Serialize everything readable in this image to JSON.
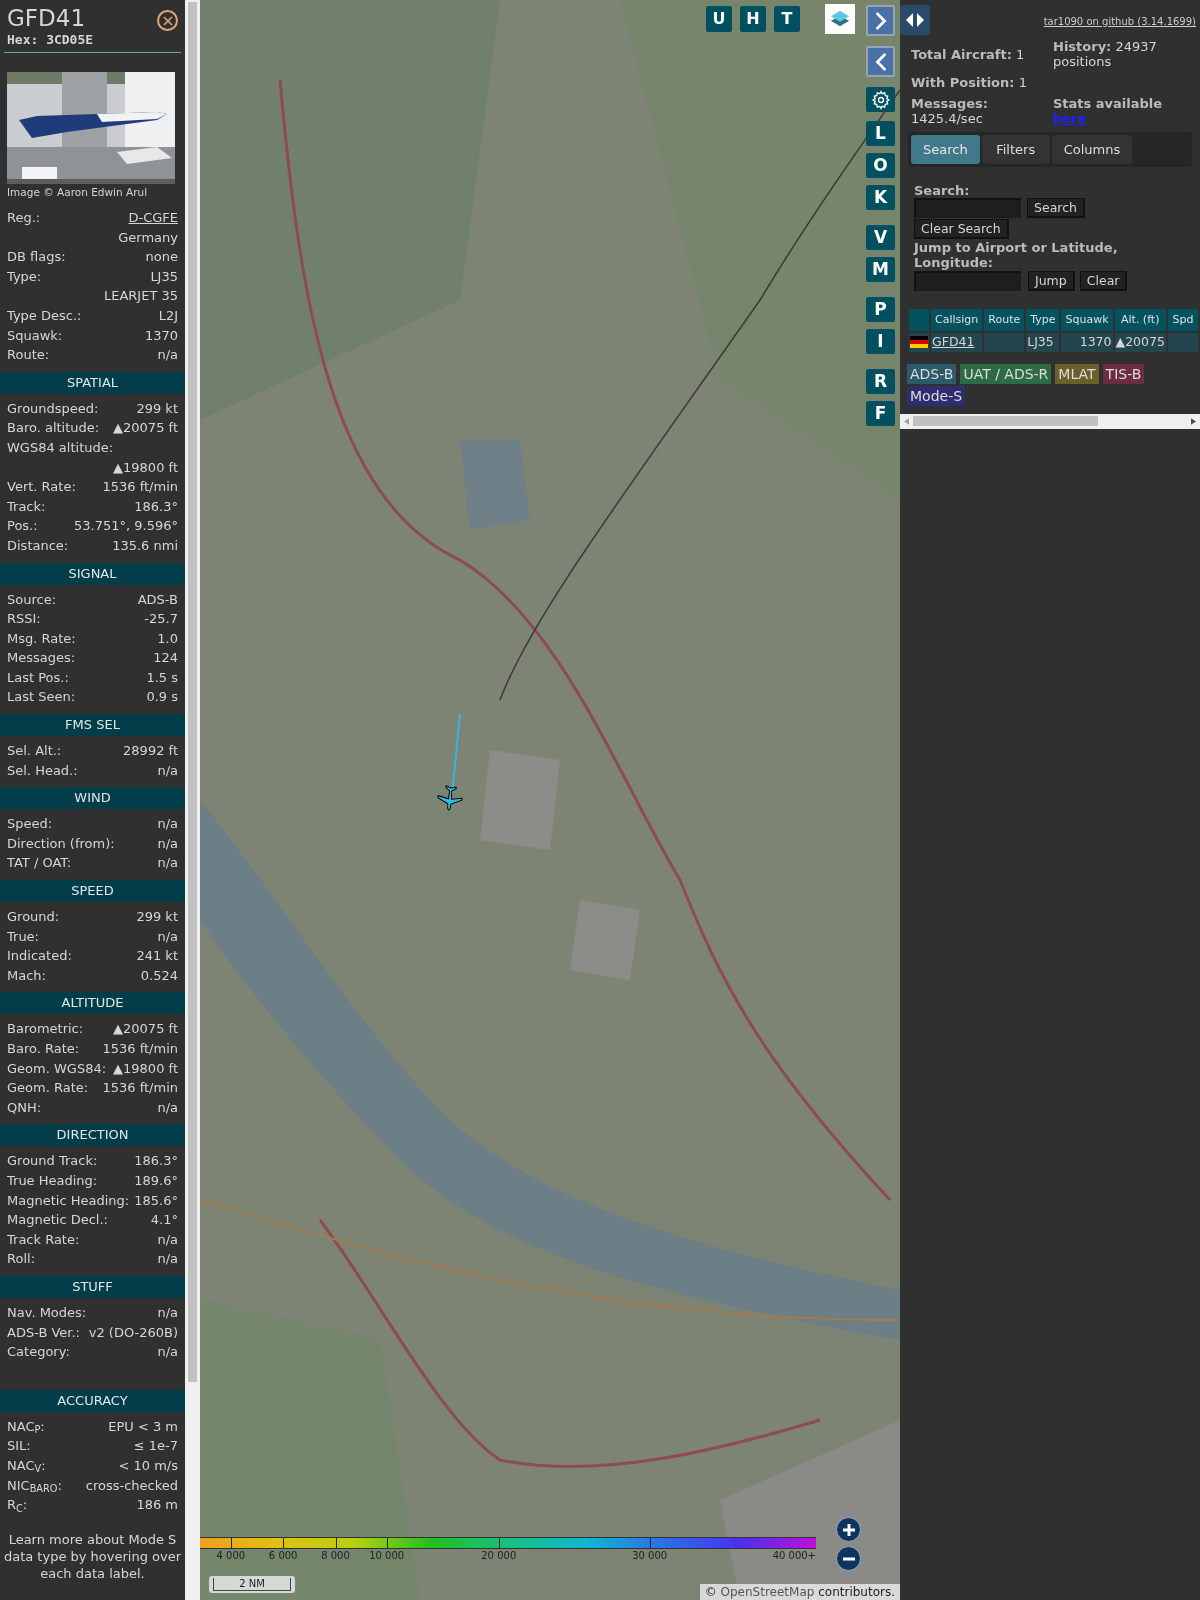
{
  "details": {
    "title": "GFD41",
    "hex": "Hex: 3CD05E",
    "photo_credit": "Image © Aaron Edwin Arul",
    "sections": [
      {
        "rows": [
          {
            "label": "Reg.:",
            "value": "D-CGFE",
            "kind": "link"
          },
          {
            "value": "Germany"
          },
          {
            "label": "DB flags:",
            "value": "none"
          },
          {
            "label": "Type:",
            "value": "LJ35"
          },
          {
            "value": "LEARJET 35"
          },
          {
            "label": "Type Desc.:",
            "value": "L2J"
          },
          {
            "label": "Squawk:",
            "value": "1370"
          },
          {
            "label": "Route:",
            "value": "n/a"
          }
        ]
      },
      {
        "heading": "SPATIAL",
        "rows": [
          {
            "label": "Groundspeed:",
            "value": "299 kt"
          },
          {
            "label": "Baro. altitude:",
            "value": "▲20075 ft"
          },
          {
            "label": "WGS84 altitude:"
          },
          {
            "value": "▲19800 ft"
          },
          {
            "label": "Vert. Rate:",
            "value": "1536 ft/min"
          },
          {
            "label": "Track:",
            "value": "186.3°"
          },
          {
            "label": "Pos.:",
            "value": "53.751°, 9.596°"
          },
          {
            "label": "Distance:",
            "value": "135.6 nmi"
          }
        ]
      },
      {
        "heading": "SIGNAL",
        "rows": [
          {
            "label": "Source:",
            "value": "ADS-B"
          },
          {
            "label": "RSSI:",
            "value": "-25.7"
          },
          {
            "label": "Msg. Rate:",
            "value": "1.0"
          },
          {
            "label": "Messages:",
            "value": "124"
          },
          {
            "label": "Last Pos.:",
            "value": "1.5 s"
          },
          {
            "label": "Last Seen:",
            "value": "0.9 s"
          }
        ]
      },
      {
        "heading": "FMS SEL",
        "rows": [
          {
            "label": "Sel. Alt.:",
            "value": "28992 ft"
          },
          {
            "label": "Sel. Head.:",
            "value": "n/a"
          }
        ]
      },
      {
        "heading": "WIND",
        "rows": [
          {
            "label": "Speed:",
            "value": "n/a"
          },
          {
            "label": "Direction (from):",
            "value": "n/a"
          },
          {
            "label": "TAT / OAT:",
            "value": "n/a"
          }
        ]
      },
      {
        "heading": "SPEED",
        "rows": [
          {
            "label": "Ground:",
            "value": "299 kt"
          },
          {
            "label": "True:",
            "value": "n/a"
          },
          {
            "label": "Indicated:",
            "value": "241 kt"
          },
          {
            "label": "Mach:",
            "value": "0.524"
          }
        ]
      },
      {
        "heading": "ALTITUDE",
        "rows": [
          {
            "label": "Barometric:",
            "value": "▲20075 ft"
          },
          {
            "label": "Baro. Rate:",
            "value": "1536 ft/min"
          },
          {
            "label": "Geom. WGS84:",
            "value": "▲19800 ft"
          },
          {
            "label": "Geom. Rate:",
            "value": "1536 ft/min"
          },
          {
            "label": "QNH:",
            "value": "n/a"
          }
        ]
      },
      {
        "heading": "DIRECTION",
        "rows": [
          {
            "label": "Ground Track:",
            "value": "186.3°"
          },
          {
            "label": "True Heading:",
            "value": "189.6°"
          },
          {
            "label": "Magnetic Heading:",
            "value": "185.6°"
          },
          {
            "label": "Magnetic Decl.:",
            "value": "4.1°"
          },
          {
            "label": "Track Rate:",
            "value": "n/a"
          },
          {
            "label": "Roll:",
            "value": "n/a"
          }
        ]
      },
      {
        "heading": "STUFF",
        "rows": [
          {
            "label": "Nav. Modes:",
            "value": "n/a"
          },
          {
            "label": "ADS-B Ver.:",
            "value": "v2 (DO-260B)"
          },
          {
            "label": "Category:",
            "value": "n/a"
          }
        ]
      },
      {
        "heading": "ACCURACY",
        "rows": [
          {
            "label": "NAC$_{P}$:",
            "value": "EPU < 3 m"
          },
          {
            "label": "SIL:",
            "value": "≤ 1e-7"
          },
          {
            "label": "NAC$_{V}$:",
            "value": "< 10 m/s"
          },
          {
            "label": "NIC$_{BARO}$:",
            "value": "cross-checked"
          },
          {
            "label": "R$_{C}$:",
            "value": "186 m"
          }
        ]
      }
    ],
    "note": "Learn more about Mode S data type by hovering over each data label."
  },
  "map": {
    "top_buttons": [
      "U",
      "H",
      "T"
    ],
    "side_buttons": [
      {
        "kind": "next"
      },
      {
        "kind": "prev"
      },
      {
        "kind": "settings"
      },
      {
        "kind": "letter",
        "label": "L"
      },
      {
        "kind": "letter",
        "label": "O"
      },
      {
        "kind": "letter",
        "label": "K"
      },
      {
        "kind": "letter",
        "label": "V"
      },
      {
        "kind": "letter",
        "label": "M"
      },
      {
        "kind": "letter",
        "label": "P"
      },
      {
        "kind": "letter",
        "label": "I"
      },
      {
        "kind": "letter",
        "label": "R"
      },
      {
        "kind": "letter",
        "label": "F"
      }
    ],
    "altitude_legend": [
      "4 000",
      "6 000",
      "8 000",
      "10 000",
      "20 000",
      "30 000",
      "40 000+"
    ],
    "scale": "2 NM",
    "attribution_prefix": "©",
    "attribution_link": "OpenStreetMap",
    "attribution_suffix": "contributors."
  },
  "panel": {
    "version_link": "tar1090 on github (3.14.1699)",
    "stats": [
      {
        "label": "Total Aircraft:",
        "value": "1"
      },
      {
        "label": "With Position:",
        "value": "1"
      },
      {
        "label": "Messages:",
        "value": "1425.4/sec"
      },
      {
        "label": "History:",
        "value": "24937 positions"
      }
    ],
    "stats_note": "Stats available",
    "stats_link": "here",
    "tabs": [
      {
        "label": "Search",
        "selected": true
      },
      {
        "label": "Filters",
        "selected": false
      },
      {
        "label": "Columns",
        "selected": false
      }
    ],
    "search_label": "Search:",
    "search_button": "Search",
    "clear_search_button": "Clear Search",
    "jump_label": "Jump to Airport or Latitude, Longitude:",
    "jump_button": "Jump",
    "clear_button": "Clear",
    "table": {
      "columns": [
        "Callsign",
        "Route",
        "Type",
        "Squawk",
        "Alt. (ft)",
        "Spd"
      ],
      "rows": [
        {
          "callsign": "GFD41",
          "route": "",
          "type": "LJ35",
          "squawk": "1370",
          "altitude": "▲20075",
          "speed": ""
        }
      ]
    },
    "sources": [
      {
        "label": "ADS-B",
        "color": "#2b5a6a"
      },
      {
        "label": "UAT / ADS-R",
        "color": "#2d6b44"
      },
      {
        "label": "MLAT",
        "color": "#6b602c"
      },
      {
        "label": "TIS-B",
        "color": "#6b2c44"
      },
      {
        "label": "Mode-S",
        "color": "#2e2e6e"
      }
    ]
  }
}
